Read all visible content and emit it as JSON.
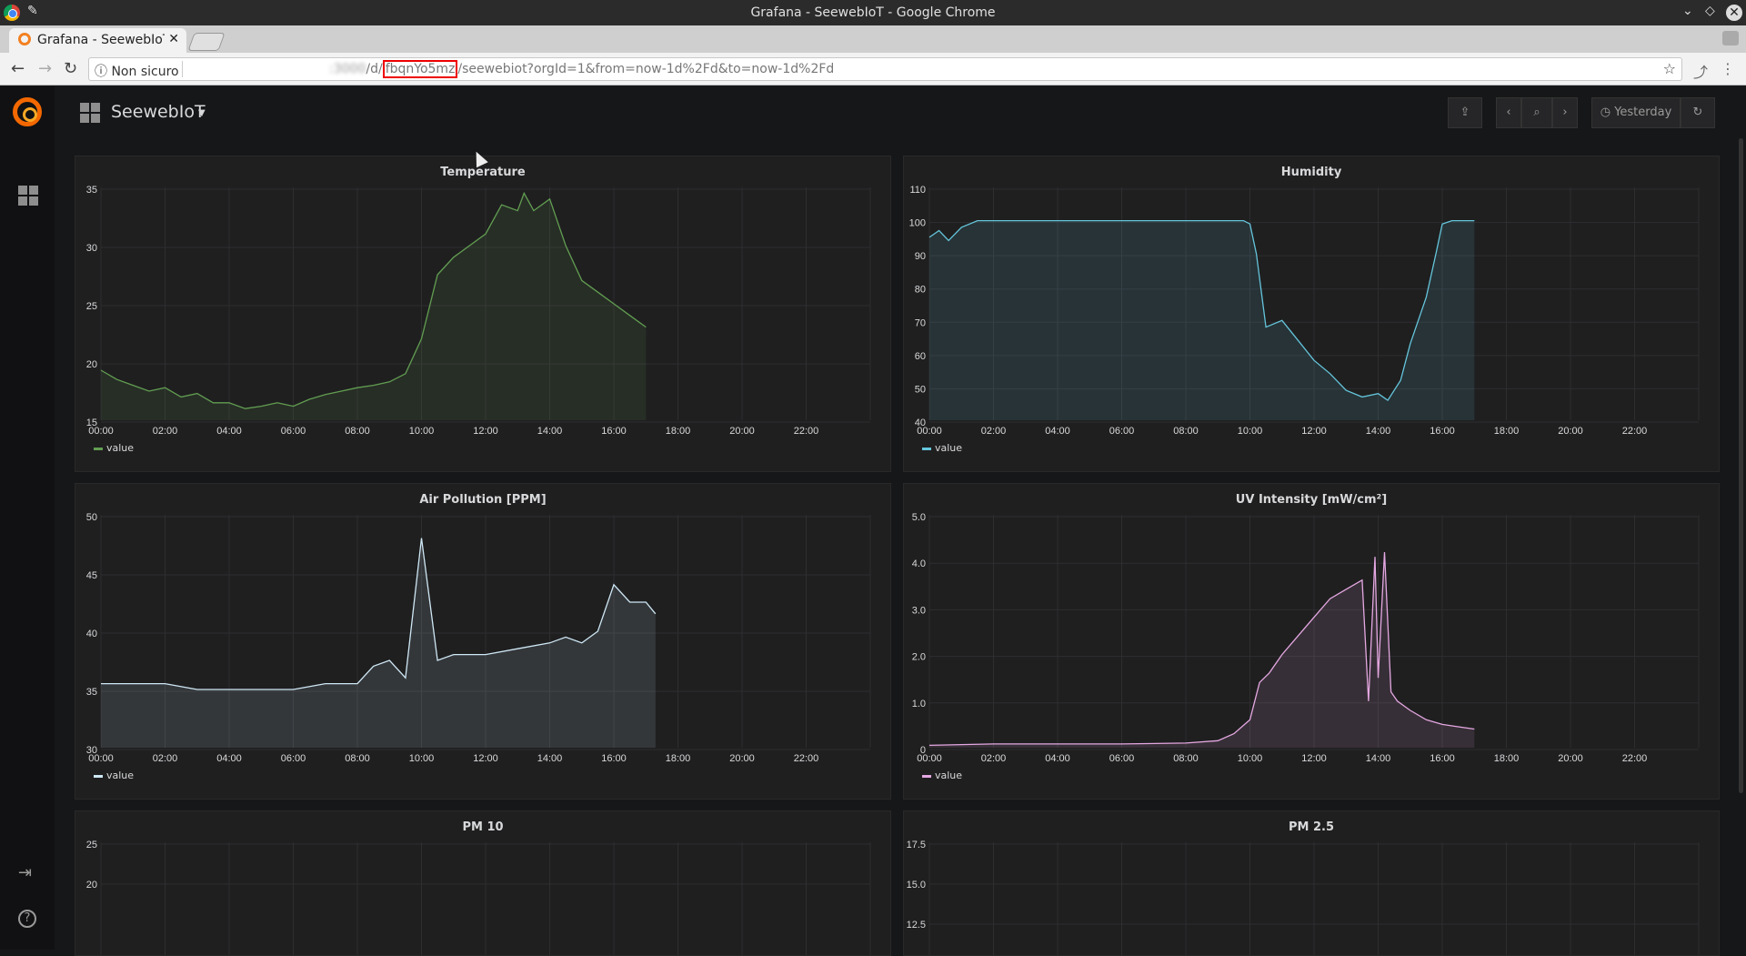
{
  "window": {
    "title": "Grafana - SeewebIoT - Google Chrome"
  },
  "tab": {
    "label": "Grafana - SeewebIoT"
  },
  "address": {
    "security": "Non sicuro",
    "host": "           :3000",
    "path_pre": "/d/",
    "path_highlight": "fbqnYo5mz",
    "path_post": "/seewebiot?orgId=1&from=now-1d%2Fd&to=now-1d%2Fd"
  },
  "dashboard": {
    "title": "SeewebIoT",
    "time_range": "Yesterday"
  },
  "legend_label": "value",
  "colors": {
    "temperature": "#629e51",
    "humidity": "#65c5db",
    "air": "#cfe8f5",
    "uv": "#e5a8e2",
    "pm10": "#e5ac0e",
    "pm25": "#ef843c"
  },
  "x_ticks": [
    "00:00",
    "02:00",
    "04:00",
    "06:00",
    "08:00",
    "10:00",
    "12:00",
    "14:00",
    "16:00",
    "18:00",
    "20:00",
    "22:00"
  ],
  "panels": {
    "temperature": {
      "title": "Temperature",
      "ylim": [
        15,
        35
      ],
      "yticks": [
        "35",
        "30",
        "25",
        "20",
        "15"
      ],
      "color": "#629e51",
      "chart_data": {
        "type": "area",
        "x": [
          0,
          0.5,
          1,
          1.5,
          2,
          2.5,
          3,
          3.5,
          4,
          4.5,
          5,
          5.5,
          6,
          6.5,
          7,
          7.5,
          8,
          8.5,
          9,
          9.5,
          10,
          10.5,
          11,
          11.5,
          12,
          12.5,
          13,
          13.2,
          13.5,
          14,
          14.5,
          15,
          15.5,
          16,
          16.5,
          17
        ],
        "y": [
          19.3,
          18.5,
          18,
          17.5,
          17.8,
          17,
          17.3,
          16.5,
          16.5,
          16,
          16.2,
          16.5,
          16.2,
          16.8,
          17.2,
          17.5,
          17.8,
          18,
          18.3,
          19,
          22,
          27.5,
          29,
          30,
          31,
          33.5,
          33,
          34.5,
          33,
          34,
          30,
          27,
          26,
          25,
          24,
          23
        ]
      }
    },
    "humidity": {
      "title": "Humidity",
      "ylim": [
        40,
        110
      ],
      "yticks": [
        "110",
        "100",
        "90",
        "80",
        "70",
        "60",
        "50",
        "40"
      ],
      "color": "#65c5db",
      "chart_data": {
        "type": "area",
        "x": [
          0,
          0.3,
          0.6,
          1,
          1.5,
          2,
          4,
          6,
          8,
          9,
          9.8,
          10,
          10.2,
          10.5,
          11,
          11.5,
          12,
          12.5,
          13,
          13.5,
          14,
          14.3,
          14.7,
          15,
          15.5,
          15.8,
          16,
          16.3,
          17
        ],
        "y": [
          95,
          97,
          94,
          98,
          100,
          100,
          100,
          100,
          100,
          100,
          100,
          99,
          90,
          68,
          70,
          64,
          58,
          54,
          49,
          47,
          48,
          46,
          52,
          63,
          77,
          90,
          99,
          100,
          100
        ]
      }
    },
    "air": {
      "title": "Air Pollution [PPM]",
      "ylim": [
        30,
        50
      ],
      "yticks": [
        "50",
        "45",
        "40",
        "35",
        "30"
      ],
      "color": "#cfe8f5",
      "chart_data": {
        "type": "area",
        "x": [
          0,
          1,
          2,
          3,
          4,
          5,
          6,
          7,
          8,
          8.5,
          9,
          9.5,
          10,
          10.5,
          11,
          12,
          13,
          14,
          14.5,
          15,
          15.5,
          16,
          16.5,
          17,
          17.3
        ],
        "y": [
          35.5,
          35.5,
          35.5,
          35,
          35,
          35,
          35,
          35.5,
          35.5,
          37,
          37.5,
          36,
          48,
          37.5,
          38,
          38,
          38.5,
          39,
          39.5,
          39,
          40,
          44,
          42.5,
          42.5,
          41.5
        ]
      }
    },
    "uv": {
      "title": "UV Intensity [mW/cm²]",
      "ylim": [
        0,
        5
      ],
      "yticks": [
        "5.0",
        "4.0",
        "3.0",
        "2.0",
        "1.0",
        "0"
      ],
      "color": "#e5a8e2",
      "chart_data": {
        "type": "area",
        "x": [
          0,
          2,
          4,
          6,
          8,
          9,
          9.5,
          10,
          10.3,
          10.6,
          11,
          11.5,
          12,
          12.5,
          13,
          13.5,
          13.7,
          13.9,
          14,
          14.2,
          14.4,
          14.6,
          15,
          15.5,
          16,
          16.5,
          17
        ],
        "y": [
          0.05,
          0.08,
          0.08,
          0.08,
          0.1,
          0.15,
          0.3,
          0.6,
          1.4,
          1.6,
          2.0,
          2.4,
          2.8,
          3.2,
          3.4,
          3.6,
          1.0,
          4.1,
          1.5,
          4.2,
          1.2,
          1.0,
          0.8,
          0.6,
          0.5,
          0.45,
          0.4
        ]
      }
    },
    "pm10": {
      "title": "PM 10",
      "yticks": [
        "25",
        "20"
      ],
      "color": "#e5ac0e"
    },
    "pm25": {
      "title": "PM 2.5",
      "yticks": [
        "17.5",
        "15.0",
        "12.5"
      ],
      "color": "#ef843c"
    }
  }
}
